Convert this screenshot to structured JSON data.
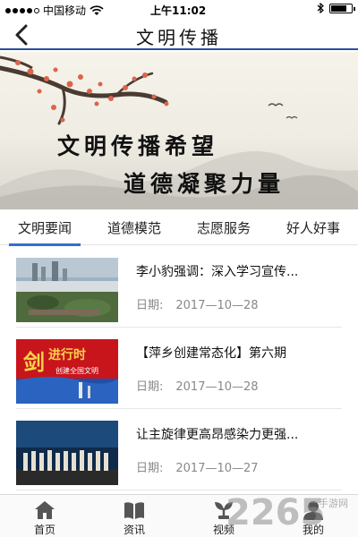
{
  "status_bar": {
    "carrier": "中国移动",
    "time": "上午11:02",
    "signal_strength": 4,
    "battery_level": 0.75
  },
  "header": {
    "title": "文明传播"
  },
  "banner": {
    "line1": "文明传播希望",
    "line2": "道德凝聚力量"
  },
  "tabs": [
    {
      "label": "文明要闻",
      "active": true
    },
    {
      "label": "道德模范",
      "active": false
    },
    {
      "label": "志愿服务",
      "active": false
    },
    {
      "label": "好人好事",
      "active": false
    }
  ],
  "news": [
    {
      "title": "李小豹强调：深入学习宣传...",
      "date_label": "日期:",
      "date": "2017—10—28"
    },
    {
      "title": "【萍乡创建常态化】第六期",
      "date_label": "日期:",
      "date": "2017—10—28"
    },
    {
      "title": "让主旋律更高昂感染力更强...",
      "date_label": "日期:",
      "date": "2017—10—27"
    }
  ],
  "bottom_nav": [
    {
      "label": "首页",
      "icon": "home-icon"
    },
    {
      "label": "资讯",
      "icon": "book-icon"
    },
    {
      "label": "视频",
      "icon": "sprout-icon"
    },
    {
      "label": "我的",
      "icon": "user-icon"
    }
  ],
  "watermark": {
    "text": "2265",
    "sub": "手游网"
  },
  "colors": {
    "accent_blue": "#2f6fd0",
    "header_line": "#2d4f9e",
    "date_gray": "#888888"
  }
}
